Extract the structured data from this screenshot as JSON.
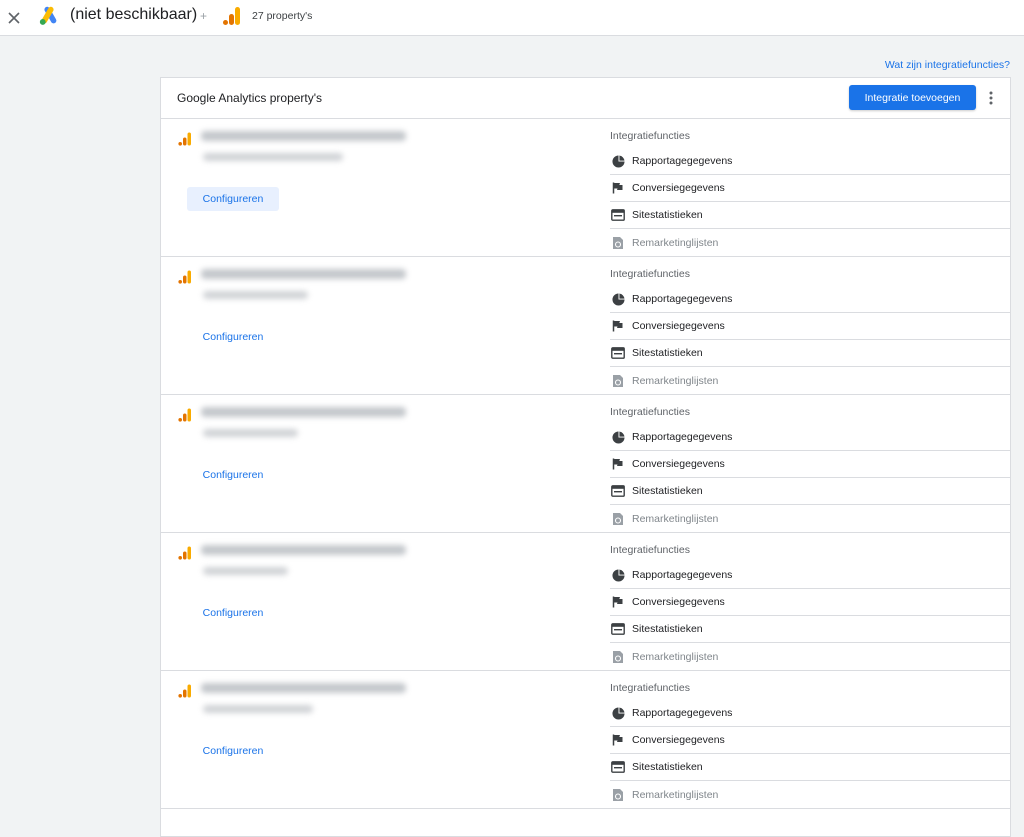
{
  "topbar": {
    "account_title": "(niet beschikbaar)",
    "separator": "+",
    "property_count": "27 property's"
  },
  "help_link": "Wat zijn integratiefuncties?",
  "card": {
    "title": "Google Analytics property's",
    "add_button": "Integratie toevoegen"
  },
  "features_heading": "Integratiefuncties",
  "feature_labels": {
    "reporting": "Rapportagegegevens",
    "conversions": "Conversiegegevens",
    "site_stats": "Sitestatistieken",
    "remarketing": "Remarketinglijsten"
  },
  "configure_label": "Configureren",
  "colors": {
    "accent": "#1a73e8",
    "ga_orange": "#f9ab00",
    "ga_dark_orange": "#e37400"
  }
}
